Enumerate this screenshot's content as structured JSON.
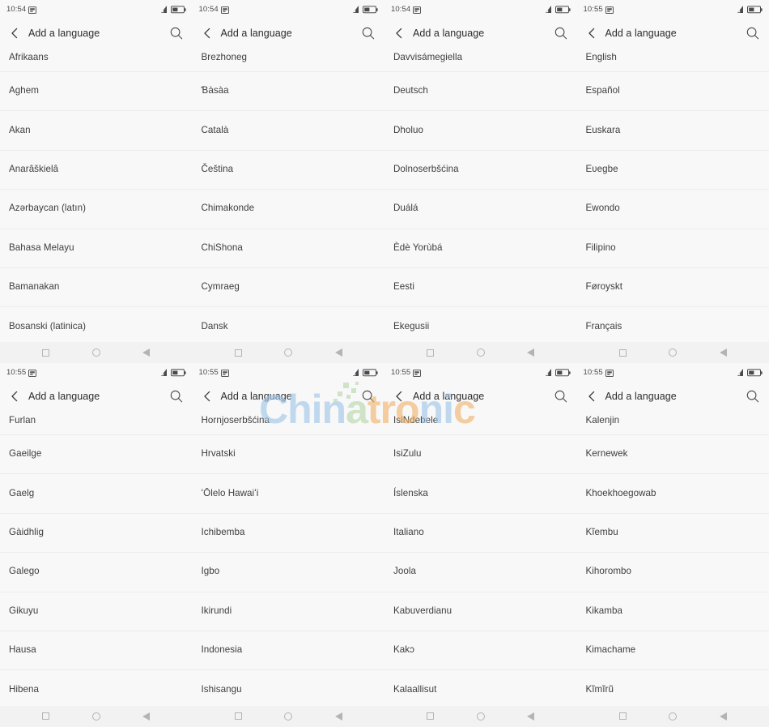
{
  "app": {
    "title": "Add a language",
    "back_icon": "chevron-left-icon",
    "search_icon": "search-icon"
  },
  "navbar": {
    "recents_label": "recents-square",
    "home_label": "home-circle",
    "back_label": "back-triangle"
  },
  "statusbar": {
    "capture_icon": "screenshot-icon",
    "signal_icon": "signal-icon",
    "battery_icon": "battery-icon"
  },
  "watermark": {
    "text": "Chinatronic",
    "colors": {
      "blue": "#9fc5e8",
      "green": "#b6d7a8",
      "orange": "#f0b26b"
    }
  },
  "colors": {
    "page_bg": "#f8f8f8",
    "nav_bg": "#f2f2f2",
    "divider": "#ececec",
    "title_text": "#2b2b2b",
    "item_text": "#3d3d3d",
    "status_text": "#4a4a4a",
    "nav_icon": "#b4b4b4"
  },
  "screens": [
    {
      "time": "10:54",
      "items": [
        "Afrikaans",
        "Aghem",
        "Akan",
        "Anarâškielâ",
        "Azərbaycan (latın)",
        "Bahasa Melayu",
        "Bamanakan",
        "Bosanski (latinica)"
      ]
    },
    {
      "time": "10:54",
      "items": [
        "Brezhoneg",
        "Ɓàsàa",
        "Català",
        "Čeština",
        "Chimakonde",
        "ChiShona",
        "Cymraeg",
        "Dansk"
      ]
    },
    {
      "time": "10:54",
      "items": [
        "Davvisámegiella",
        "Deutsch",
        "Dholuo",
        "Dolnoserbšćina",
        "Duálá",
        "Èdè Yorùbá",
        "Eesti",
        "Ekegusii"
      ]
    },
    {
      "time": "10:55",
      "items": [
        "English",
        "Español",
        "Euskara",
        "Eʋegbe",
        "Ewondo",
        "Filipino",
        "Føroyskt",
        "Français"
      ]
    },
    {
      "time": "10:55",
      "items": [
        "Furlan",
        "Gaeilge",
        "Gaelg",
        "Gàidhlig",
        "Galego",
        "Gikuyu",
        "Hausa",
        "Hibena"
      ]
    },
    {
      "time": "10:55",
      "items": [
        "Hornjoserbšćina",
        "Hrvatski",
        "ʻŌlelo Hawaiʻi",
        "Ichibemba",
        "Igbo",
        "Ikirundi",
        "Indonesia",
        "Ishisangu"
      ]
    },
    {
      "time": "10:55",
      "items": [
        "IsiNdebele",
        "IsiZulu",
        "Íslenska",
        "Italiano",
        "Joola",
        "Kabuverdianu",
        "Kakɔ",
        "Kalaallisut"
      ]
    },
    {
      "time": "10:55",
      "items": [
        "Kalenjin",
        "Kernewek",
        "Khoekhoegowab",
        "Kĩembu",
        "Kihorombo",
        "Kikamba",
        "Kimachame",
        "Kĩmĩrũ"
      ]
    }
  ]
}
